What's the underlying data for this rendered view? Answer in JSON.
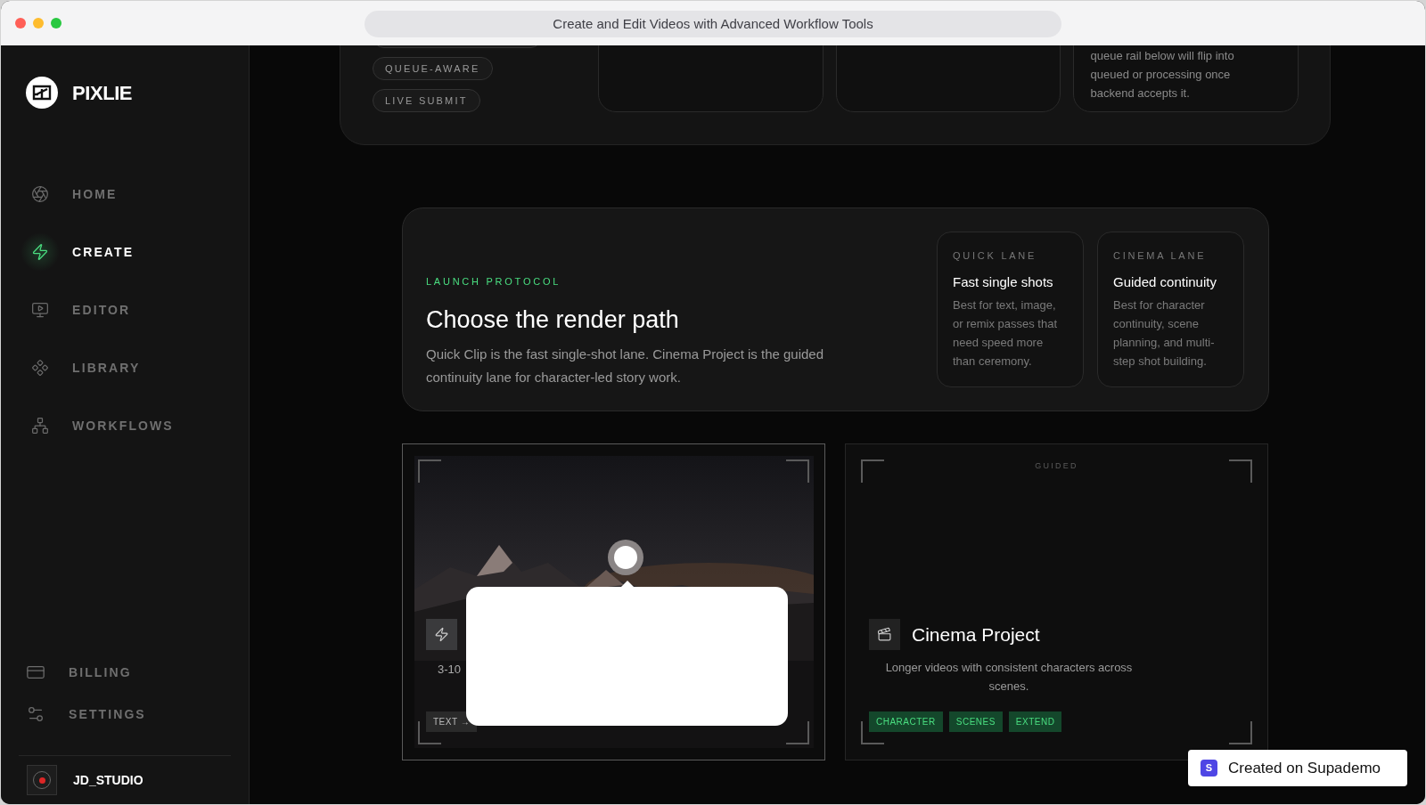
{
  "window": {
    "title": "Create and Edit Videos with Advanced Workflow Tools"
  },
  "sidebar": {
    "brand": "PIXLIE",
    "items": [
      {
        "label": "HOME",
        "selected": false
      },
      {
        "label": "CREATE",
        "selected": true
      },
      {
        "label": "EDITOR",
        "selected": false
      },
      {
        "label": "LIBRARY",
        "selected": false
      },
      {
        "label": "WORKFLOWS",
        "selected": false
      }
    ],
    "footer_items": [
      {
        "label": "BILLING"
      },
      {
        "label": "SETTINGS"
      }
    ],
    "user": {
      "name": "JD_STUDIO"
    }
  },
  "top_panel": {
    "tags": [
      "QUEUE-AWARE",
      "LIVE SUBMIT"
    ],
    "cards": [
      {
        "kind": "empty"
      },
      {
        "kind": "empty"
      },
      {
        "kind": "text",
        "text": "queue rail below will flip into queued or processing once backend accepts it."
      }
    ]
  },
  "launch": {
    "eyebrow": "LAUNCH PROTOCOL",
    "title": "Choose the render path",
    "description": "Quick Clip is the fast single-shot lane. Cinema Project is the guided continuity lane for character-led story work.",
    "lanes": [
      {
        "label": "QUICK LANE",
        "title": "Fast single shots",
        "description": "Best for text, image, or remix passes that need speed more than ceremony."
      },
      {
        "label": "CINEMA LANE",
        "title": "Guided continuity",
        "description": "Best for character continuity, scene planning, and multi-step shot building."
      }
    ]
  },
  "modes": [
    {
      "kind": "quick",
      "duration": "3-10",
      "tags": [
        "TEXT →"
      ]
    },
    {
      "kind": "cinema",
      "badge": "GUIDED",
      "title": "Cinema Project",
      "description": "Longer videos with consistent characters across scenes.",
      "tags": [
        "CHARACTER",
        "SCENES",
        "EXTEND"
      ]
    }
  ],
  "tour": {
    "logo": "S",
    "badge": "Created on Supademo"
  }
}
